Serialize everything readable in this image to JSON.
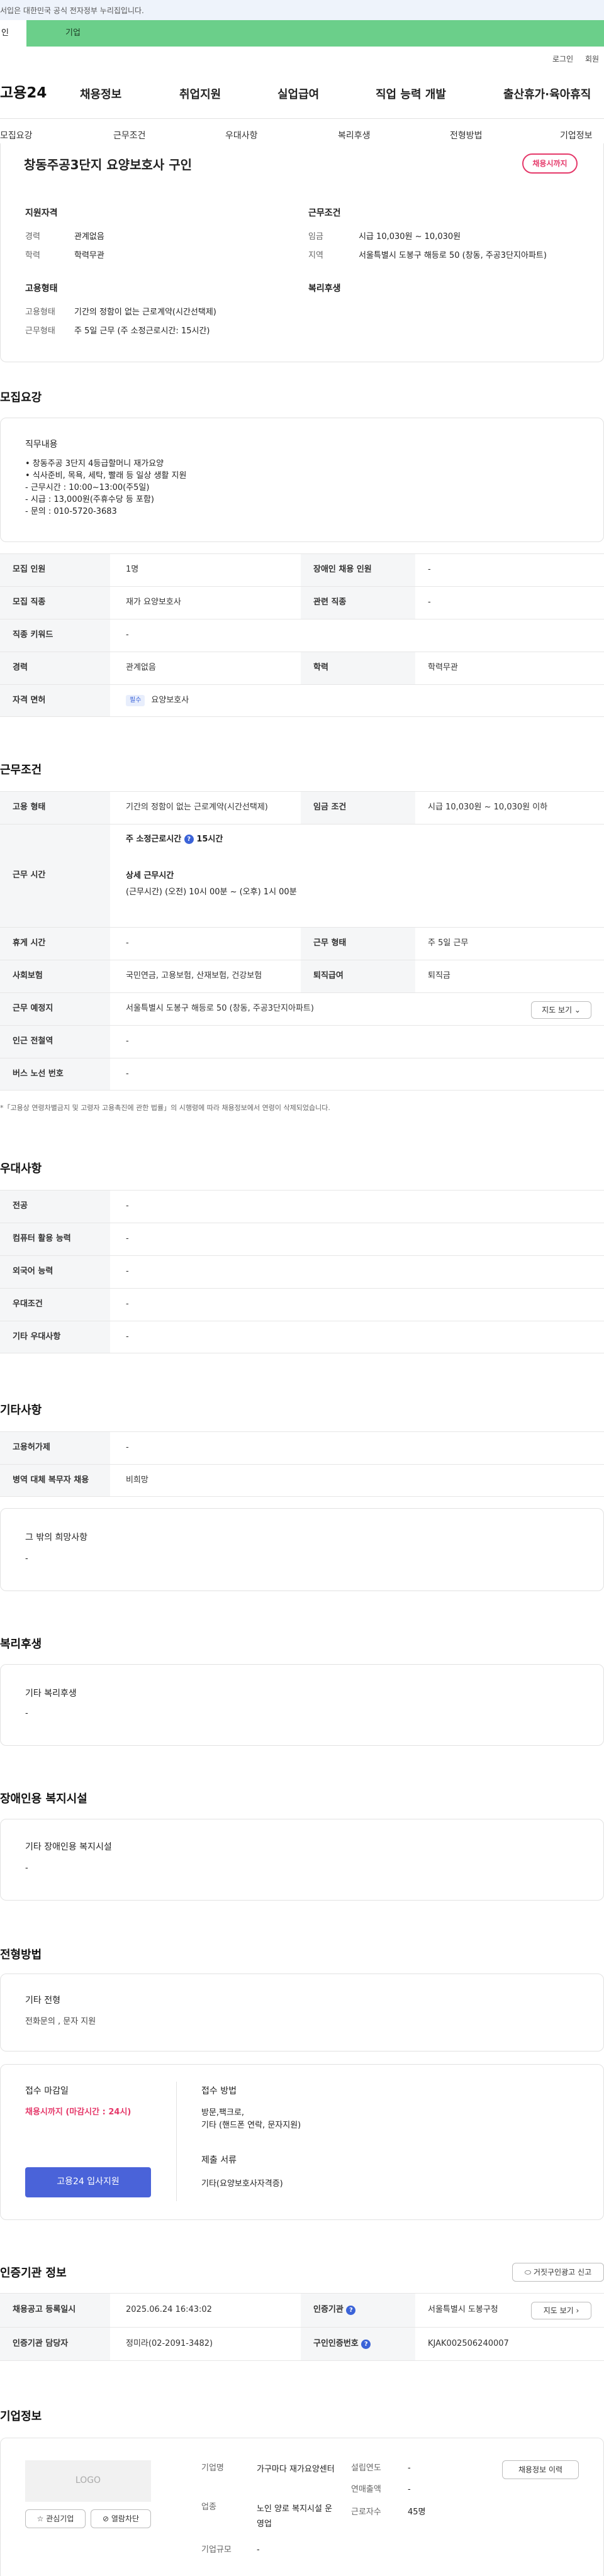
{
  "top_notice": "서입은 대한민국 공식 전자정부 누리집입니다.",
  "user_tabs": {
    "individual": "인",
    "corporate": "기업"
  },
  "util": {
    "login": "로그인",
    "signup": "회원"
  },
  "logo": "고용24",
  "gnb": [
    "채용정보",
    "취업지원",
    "실업급여",
    "직업 능력 개발",
    "출산휴가·육아휴직"
  ],
  "lnb": [
    "모집요강",
    "근무조건",
    "우대사항",
    "복리후생",
    "전형방법",
    "기업정보"
  ],
  "job": {
    "title": "창동주공3단지 요양보호사 구인",
    "status_badge": "채용시까지"
  },
  "summary": {
    "qual_title": "지원자격",
    "career_lbl": "경력",
    "career": "관계없음",
    "edu_lbl": "학력",
    "edu": "학력무관",
    "cond_title": "근무조건",
    "wage_lbl": "임금",
    "wage": "시급 10,030원 ~ 10,030원",
    "region_lbl": "지역",
    "region": "서울특별시 도봉구 해등로 50 (창동, 주공3단지아파트)",
    "emp_title": "고용형태",
    "emptype_lbl": "고용형태",
    "emptype": "기간의 정함이 없는 근로계약(시간선택제)",
    "worktype_lbl": "근무형태",
    "worktype": "주 5일 근무 (주 소정근로시간: 15시간)",
    "welfare_title": "복리후생"
  },
  "recruit": {
    "section": "모집요강",
    "duty_title": "직무내용",
    "duty_text": "• 창동주공 3단지 4등급할머니 재가요양\n• 식사준비, 목욕, 세탁, 빨래 등 일상 생활 지원\n- 근무시간 : 10:00~13:00(주5일)\n- 시급 : 13,000원(주휴수당 등 포함)\n- 문의 : 010-5720-3683",
    "rows": {
      "headcount_lbl": "모집 인원",
      "headcount": "1명",
      "disabled_lbl": "장애인 채용 인원",
      "disabled": "-",
      "position_lbl": "모집 직종",
      "position": "재가 요양보호사",
      "related_lbl": "관련 직종",
      "related": "-",
      "keyword_lbl": "직종 키워드",
      "keyword": "-",
      "career_lbl": "경력",
      "career": "관계없음",
      "edu_lbl": "학력",
      "edu": "학력무관",
      "license_lbl": "자격 면허",
      "license_tag": "필수",
      "license": "요양보호사"
    }
  },
  "conditions": {
    "section": "근무조건",
    "emptype_lbl": "고용 형태",
    "emptype": "기간의 정함이 없는 근로계약(시간선택제)",
    "wage_lbl": "임금 조건",
    "wage": "시급 10,030원 ~ 10,030원 이하",
    "hours_lbl": "근무 시간",
    "weekly_lbl": "주 소정근로시간",
    "weekly": "15시간",
    "detail_lbl": "상세 근무시간",
    "detail": "(근무시간) (오전) 10시 00분 ~ (오후) 1시 00분",
    "rest_lbl": "휴게 시간",
    "rest": "-",
    "form_lbl": "근무 형태",
    "form": "주 5일 근무",
    "ins_lbl": "사회보험",
    "ins": "국민연금, 고용보험, 산재보험, 건강보험",
    "sev_lbl": "퇴직급여",
    "sev": "퇴직금",
    "place_lbl": "근무 예정지",
    "place": "서울특별시 도봉구 해등로 50 (창동, 주공3단지아파트)",
    "map_btn": "지도 보기",
    "subway_lbl": "인근 전철역",
    "subway": "-",
    "bus_lbl": "버스 노선 번호",
    "bus": "-",
    "note": "*「고용상 연령차별금지 및 고령자 고용촉진에 관한 법률」의 시행령에 따라 채용정보에서 연령이 삭제되었습니다."
  },
  "preference": {
    "section": "우대사항",
    "rows": [
      [
        "전공",
        "-"
      ],
      [
        "컴퓨터 활용 능력",
        "-"
      ],
      [
        "외국어 능력",
        "-"
      ],
      [
        "우대조건",
        "-"
      ],
      [
        "기타 우대사항",
        "-"
      ]
    ]
  },
  "other": {
    "section": "기타사항",
    "rows": [
      [
        "고용허가제",
        "-"
      ],
      [
        "병역 대체 복무자 채용",
        "비희망"
      ]
    ],
    "wish_title": "그 밖의 희망사항",
    "wish": "-"
  },
  "welfare": {
    "section": "복리후생",
    "title": "기타 복리후생",
    "value": "-"
  },
  "disability": {
    "section": "장애인용 복지시설",
    "title": "기타 장애인용 복지시설",
    "value": "-"
  },
  "selection": {
    "section": "전형방법",
    "other_title": "기타 전형",
    "other": "전화문의 , 문자 지원",
    "deadline_title": "접수 마감일",
    "deadline": "채용시까지 (마감시간 : 24시)",
    "method_title": "접수 방법",
    "method": "방문,팩크로,\n기타 (핸드폰 연락, 문자지원)",
    "docs_title": "제출 서류",
    "docs": "기타(요양보호사자격증)",
    "apply_btn": "고용24 입사지원"
  },
  "agency": {
    "section": "인증기관 정보",
    "report_btn": "거짓구인광고 신고",
    "reg_lbl": "채용공고 등록일시",
    "reg": "2025.06.24 16:43:02",
    "agency_lbl": "인증기관",
    "agency": "서울특별시 도봉구청",
    "map_btn": "지도 보기",
    "manager_lbl": "인증기관 담당자",
    "manager": "정미라(02-2091-3482)",
    "num_lbl": "구인인증번호",
    "num": "KJAK002506240007"
  },
  "company": {
    "section": "기업정보",
    "logo_text": "LOGO",
    "fav_btn": "관심기업",
    "block_btn": "열람차단",
    "name_lbl": "기업명",
    "name": "가구마다 재가요양센터",
    "year_lbl": "설립연도",
    "year": "-",
    "sales_lbl": "연매출액",
    "sales": "-",
    "industry_lbl": "업종",
    "industry": "노인 양로 복지시설 운영업",
    "emp_lbl": "근로자수",
    "emp": "45명",
    "size_lbl": "기업규모",
    "size": "-",
    "jobs_btn": "채용정보 이력"
  }
}
